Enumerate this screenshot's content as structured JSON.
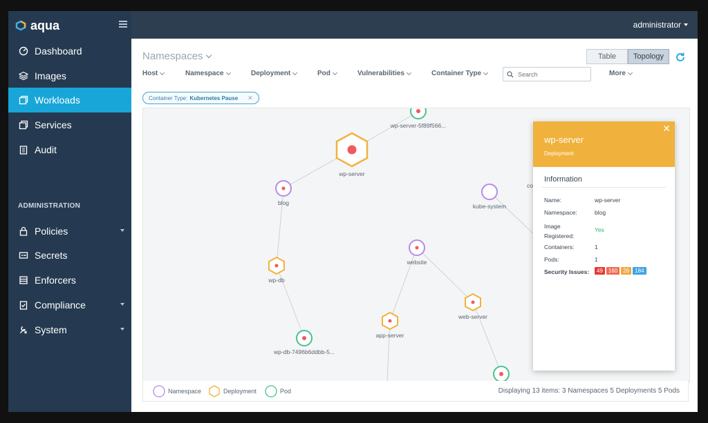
{
  "app": {
    "logo_text": "aqua",
    "user": "administrator"
  },
  "sidebar": {
    "items": [
      {
        "label": "Dashboard",
        "icon": "gauge-icon"
      },
      {
        "label": "Images",
        "icon": "layers-icon"
      },
      {
        "label": "Workloads",
        "icon": "workloads-icon",
        "active": true
      },
      {
        "label": "Services",
        "icon": "services-icon"
      },
      {
        "label": "Audit",
        "icon": "clipboard-icon"
      }
    ],
    "admin_label": "ADMINISTRATION",
    "admin_items": [
      {
        "label": "Policies",
        "icon": "lock-icon",
        "expandable": true
      },
      {
        "label": "Secrets",
        "icon": "secrets-icon"
      },
      {
        "label": "Enforcers",
        "icon": "enforcers-icon"
      },
      {
        "label": "Compliance",
        "icon": "compliance-icon",
        "expandable": true
      },
      {
        "label": "System",
        "icon": "tools-icon",
        "expandable": true
      }
    ]
  },
  "page": {
    "title": "Namespaces",
    "view_toggle": {
      "table": "Table",
      "topology": "Topology",
      "selected": "Topology"
    },
    "filters": [
      "Host",
      "Namespace",
      "Deployment",
      "Pod",
      "Vulnerabilities",
      "Container Type"
    ],
    "search_placeholder": "Search",
    "more_label": "More",
    "active_filter": {
      "label": "Container Type:",
      "value": "Kubernetes Pause"
    }
  },
  "topology": {
    "nodes": [
      {
        "label": "wp-server-5f89f566...",
        "type": "pod"
      },
      {
        "label": "wp-server",
        "type": "deployment",
        "selected": true
      },
      {
        "label": "blog",
        "type": "namespace"
      },
      {
        "label": "kube-system",
        "type": "namespace"
      },
      {
        "label": "co",
        "type": "namespace"
      },
      {
        "label": "website",
        "type": "namespace"
      },
      {
        "label": "wp-db",
        "type": "deployment"
      },
      {
        "label": "web-server",
        "type": "deployment"
      },
      {
        "label": "app-server",
        "type": "deployment"
      },
      {
        "label": "wp-db-7496b6ddbb-5...",
        "type": "pod"
      }
    ]
  },
  "legend": {
    "namespace": "Namespace",
    "deployment": "Deployment",
    "pod": "Pod",
    "status": "Displaying 13 items: 3 Namespaces 5 Deployments 5 Pods"
  },
  "colors": {
    "namespace": "#b68ae6",
    "deployment": "#f0b23c",
    "pod": "#46c28e",
    "accent": "#18a6d9",
    "node_dot": "#ef5b5b"
  },
  "details": {
    "title": "wp-server",
    "subtitle": "Deployment",
    "section": "Information",
    "fields": [
      {
        "label": "Name:",
        "value": "wp-server"
      },
      {
        "label": "Namespace:",
        "value": "blog"
      },
      {
        "label": "Image Registered:",
        "value": "Yes"
      },
      {
        "label": "Containers:",
        "value": "1"
      },
      {
        "label": "Pods:",
        "value": "1"
      }
    ],
    "security_label": "Security Issues:",
    "security": [
      {
        "value": "49",
        "color": "#e53935"
      },
      {
        "value": "160",
        "color": "#ef6c50"
      },
      {
        "value": "26",
        "color": "#f0a742"
      },
      {
        "value": "184",
        "color": "#3fa3e0"
      }
    ]
  }
}
